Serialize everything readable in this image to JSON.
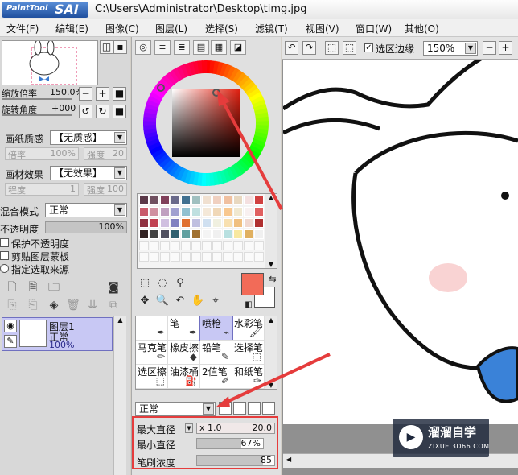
{
  "window": {
    "logo_small": "PaintTool",
    "logo_big": "SAI",
    "path": "C:\\Users\\Administrator\\Desktop\\timg.jpg"
  },
  "menu": [
    "文件(F)",
    "编辑(E)",
    "图像(C)",
    "图层(L)",
    "选择(S)",
    "滤镜(T)",
    "视图(V)",
    "窗口(W)",
    "其他(O)"
  ],
  "navigator": {
    "zoom_label": "缩放倍率",
    "zoom_value": "150.0%",
    "rotate_label": "旋转角度",
    "rotate_value": "+000"
  },
  "paper": {
    "quality_label": "画纸质感",
    "quality_value": "【无质感】",
    "ratio_label": "倍率",
    "ratio_value": "100%",
    "strength_label": "强度",
    "strength_value": "20"
  },
  "effect": {
    "label": "画材效果",
    "value": "【无效果】",
    "degree_label": "程度",
    "degree_value": "1",
    "strength_label": "强度",
    "strength_value": "100"
  },
  "blend": {
    "label": "混合模式",
    "value": "正常",
    "opacity_label": "不透明度",
    "opacity_value": "100%"
  },
  "checkboxes": [
    "保护不透明度",
    "剪贴图层蒙板",
    "指定选取来源"
  ],
  "layer": {
    "name": "图层1",
    "mode": "正常",
    "opacity": "100%"
  },
  "brushes": [
    {
      "name": "",
      "icon": "pen"
    },
    {
      "name": "笔",
      "icon": "pen"
    },
    {
      "name": "喷枪",
      "icon": "airbrush"
    },
    {
      "name": "水彩笔",
      "icon": "brush"
    },
    {
      "name": "马克笔",
      "icon": "marker"
    },
    {
      "name": "橡皮擦",
      "icon": "eraser"
    },
    {
      "name": "铅笔",
      "icon": "pencil"
    },
    {
      "name": "选择笔",
      "icon": "select"
    },
    {
      "name": "选区擦",
      "icon": "select-erase"
    },
    {
      "name": "油漆桶",
      "icon": "bucket"
    },
    {
      "name": "2值笔",
      "icon": "pen2"
    },
    {
      "name": "和纸笔",
      "icon": "paper-brush"
    }
  ],
  "brush_mode": "正常",
  "params": {
    "max_label": "最大直径",
    "max_mult": "x 1.0",
    "max_value": "20.0",
    "min_label": "最小直径",
    "min_value": "67%",
    "min_fraction": 0.67,
    "density_label": "笔刷浓度",
    "density_value": "85",
    "density_fraction": 0.85
  },
  "canvas_toolbar": {
    "checkbox_label": "选区边缘",
    "zoom": "150%"
  },
  "colors": {
    "fg": "#f26b58",
    "bg": "#ffffff",
    "accent_red": "#e53c3c"
  },
  "swatches": [
    "#5a3848",
    "#705060",
    "#80405a",
    "#6a6a8a",
    "#407090",
    "#a0c0c0",
    "#f0e0d0",
    "#f0d0c0",
    "#f0c0a0",
    "#e8d8c0",
    "#f4e0e0",
    "#d04040",
    "#c85a6a",
    "#d090a0",
    "#c0a0c0",
    "#a0a0d0",
    "#90c0d0",
    "#c0e0e0",
    "#f4e8d8",
    "#f0d8b8",
    "#f8c890",
    "#f0e8d0",
    "#f8f0f0",
    "#e06060",
    "#903040",
    "#c04050",
    "#d0c0e0",
    "#8080c0",
    "#e07030",
    "#c0c0e0",
    "#d0e0f0",
    "#f0f0e0",
    "#f8e0b0",
    "#f0c080",
    "#f0d8d0",
    "#b03030",
    "#302020",
    "#404040",
    "#505060",
    "#306070",
    "#60a0a0",
    "#a07030",
    "#f4f4f4",
    "#f0f0f0",
    "#b8e0e0",
    "#f8e8a0",
    "#e0b060",
    "#f0f0f0"
  ],
  "watermark": {
    "title": "溜溜自学",
    "sub": "ZIXUE.3D66.COM"
  }
}
